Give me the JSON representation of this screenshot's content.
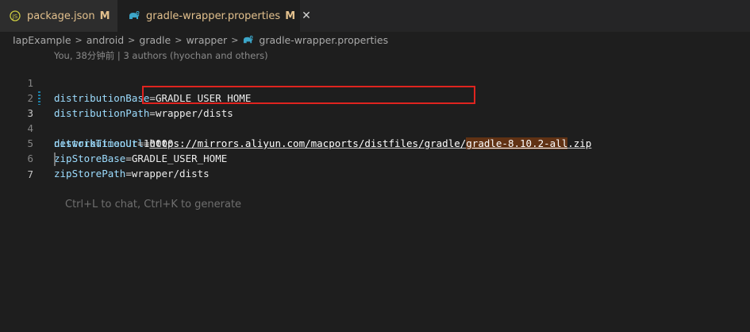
{
  "tabs": [
    {
      "icon": "js-braces-icon",
      "label": "package.json",
      "status": "M",
      "active": false
    },
    {
      "icon": "gradle-elephant-icon",
      "label": "gradle-wrapper.properties",
      "status": "M",
      "active": true,
      "close": "✕"
    }
  ],
  "breadcrumb": {
    "items": [
      "IapExample",
      "android",
      "gradle",
      "wrapper",
      "gradle-wrapper.properties"
    ],
    "separator": ">"
  },
  "editor": {
    "blame": "You, 38分钟前 | 3 authors (hyochan and others)",
    "lines": [
      {
        "num": "1",
        "key": "distributionBase",
        "eq": "=",
        "value": "GRADLE_USER_HOME"
      },
      {
        "num": "2",
        "key": "distributionPath",
        "eq": "=",
        "value": "wrapper/dists"
      },
      {
        "num": "3",
        "key": "distributionUrl",
        "eq": "=",
        "url": "https://mirrors.aliyun.com/macports/distfiles/gradle/",
        "highlight": "gradle-8.10.2-all",
        "suffix": ".zip"
      },
      {
        "num": "4",
        "key": "networkTimeout",
        "eq": "=",
        "value": "10000"
      },
      {
        "num": "5",
        "key": "zipStoreBase",
        "eq": "=",
        "value": "GRADLE_USER_HOME"
      },
      {
        "num": "6",
        "key": "zipStorePath",
        "eq": "=",
        "value": "wrapper/dists"
      },
      {
        "num": "7",
        "hint": "Ctrl+L to chat, Ctrl+K to generate"
      }
    ]
  },
  "colors": {
    "modified": "#e2c08d",
    "key": "#9cdcfe",
    "annotation_box": "#e0241f",
    "highlight_bg": "#613214"
  }
}
